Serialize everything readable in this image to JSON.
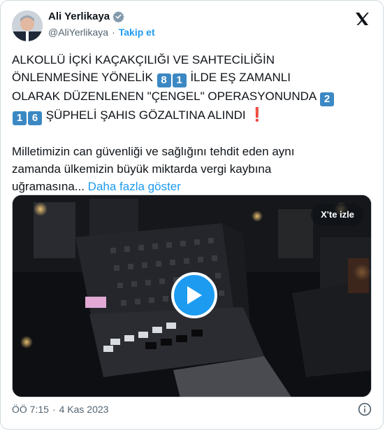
{
  "author": {
    "name": "Ali Yerlikaya",
    "handle": "@AliYerlikaya",
    "separator": "·",
    "follow_label": "Takip et"
  },
  "tweet": {
    "line1": "ALKOLLÜ İÇKİ KAÇAKÇILIĞI VE SAHTECİLİĞİN",
    "line2_pre": "ÖNLENMESİNE YÖNELİK ",
    "key_8": "8",
    "key_1": "1",
    "line2_post": " İLDE EŞ ZAMANLI",
    "line3_pre": "OLARAK DÜZENLENEN \"ÇENGEL\" OPERASYONUNDA ",
    "key_2": "2",
    "key_1b": "1",
    "key_6": "6",
    "line4_post": " ŞÜPHELİ ŞAHIS GÖZALTINA ALINDI ",
    "exclamation": "❗",
    "body": "Milletimizin can güvenliği ve sağlığını tehdit eden aynı\nzamanda ülkemizin büyük miktarda vergi kaybına\nuğramasına... ",
    "more_label": "Daha fazla göster"
  },
  "media": {
    "watch_label": "X'te izle"
  },
  "footer": {
    "time": "ÖÖ 7:15",
    "separator": "·",
    "date": "4 Kas 2023"
  },
  "icons": {
    "verified": "verified-badge-icon",
    "x_logo": "x-logo-icon",
    "play": "play-icon",
    "info": "info-icon"
  },
  "colors": {
    "accent": "#1d9bf0",
    "keycap": "#3b88c3",
    "text": "#0f1419",
    "muted": "#536471"
  }
}
